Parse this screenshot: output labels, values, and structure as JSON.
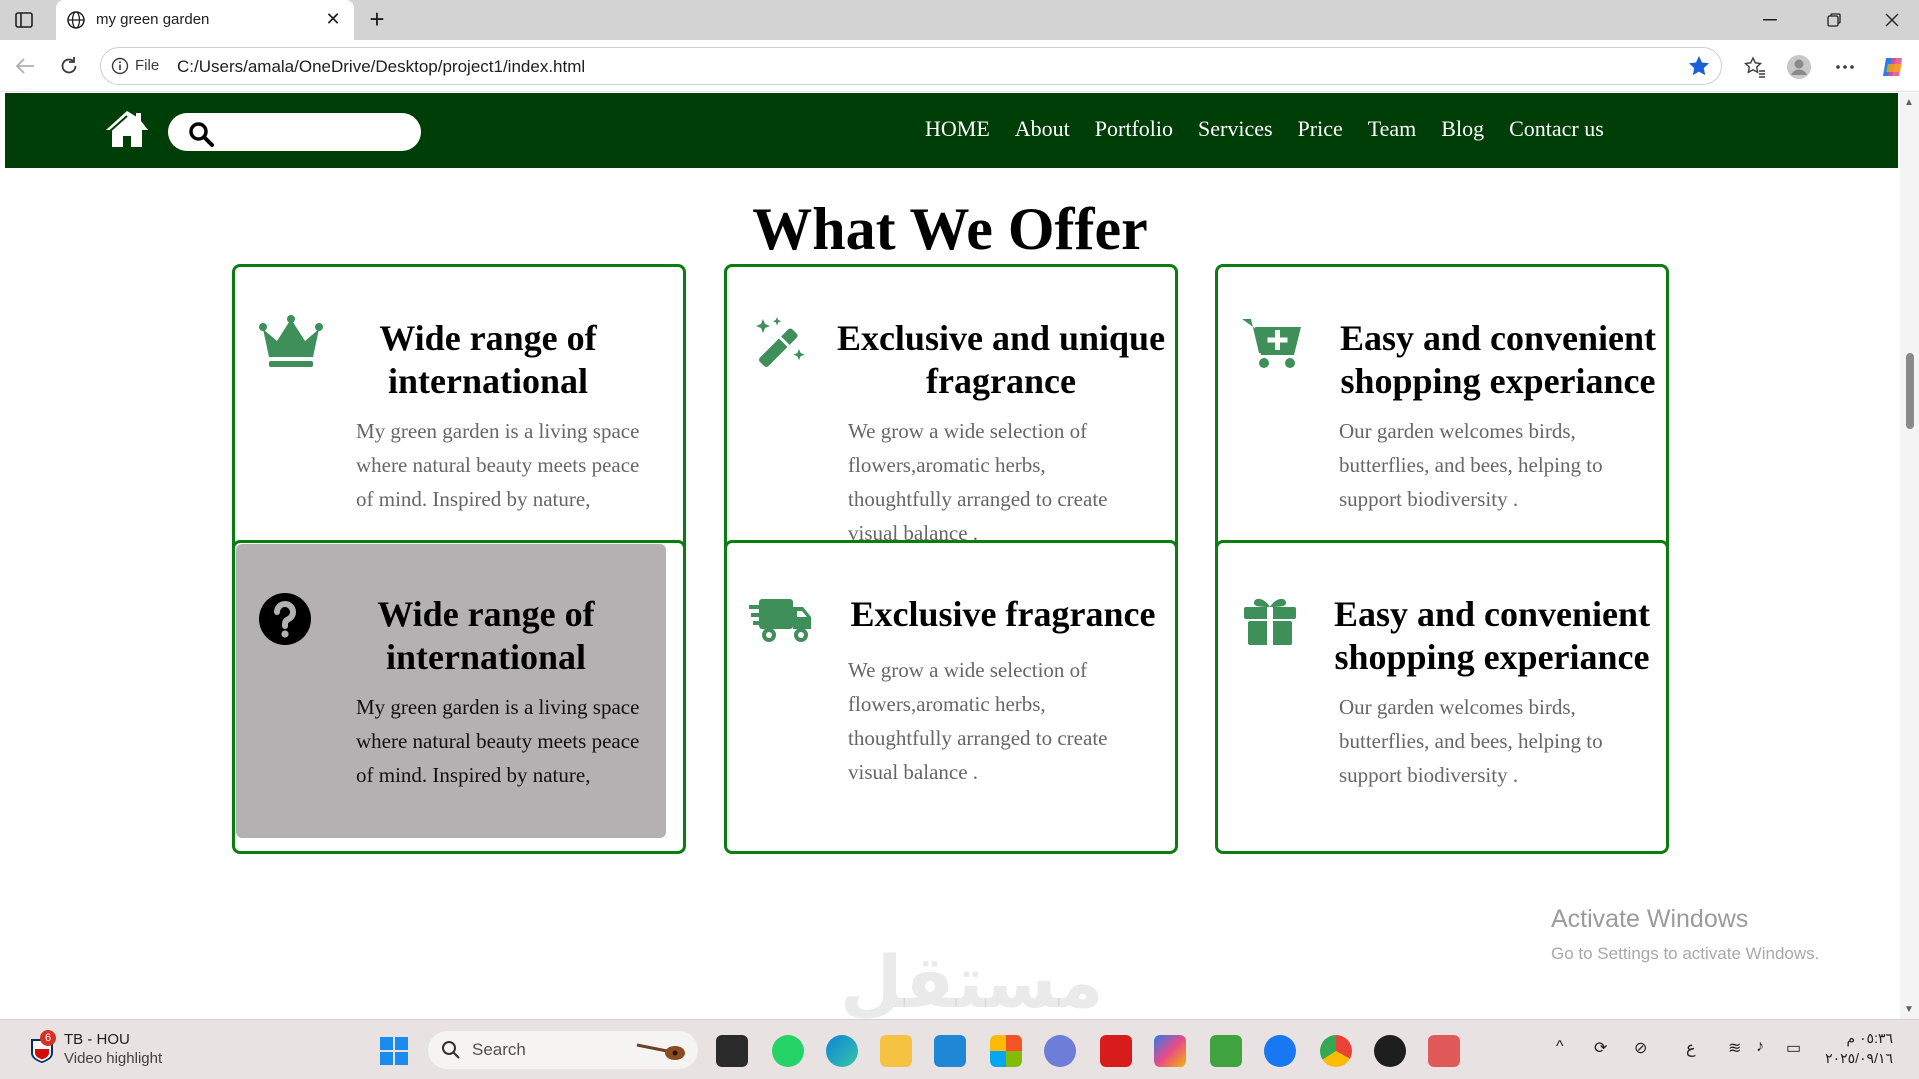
{
  "browser": {
    "tab_title": "my green garden",
    "scheme_label": "File",
    "url": "C:/Users/amala/OneDrive/Desktop/project1/index.html",
    "new_tab_symbol": "+",
    "close_symbol": "✕"
  },
  "site": {
    "search_placeholder": "",
    "menu": [
      "HOME",
      "About",
      "Portfolio",
      "Services",
      "Price",
      "Team",
      "Blog",
      "Contacr us"
    ],
    "section_title": "What We Offer",
    "brand_color": "#003e07",
    "card_border_color": "#0a7c10",
    "icon_color": "#3f8f5b"
  },
  "cards": [
    {
      "icon": "crown-icon",
      "title_l1": "Wide range of",
      "title_l2": "international",
      "text": [
        "My green garden is a living space",
        "where natural beauty meets peace",
        "of mind. Inspired by nature,"
      ]
    },
    {
      "icon": "magic-wand-icon",
      "title_l1": "Exclusive and unique",
      "title_l2": "fragrance",
      "text": [
        "We grow a wide selection of",
        "flowers,aromatic herbs,",
        "thoughtfully arranged to create",
        "visual balance ."
      ]
    },
    {
      "icon": "cart-plus-icon",
      "title_l1": "Easy and convenient",
      "title_l2": "shopping experiance",
      "text": [
        "Our garden welcomes birds,",
        "butterflies, and bees, helping to",
        "support biodiversity ."
      ]
    },
    {
      "icon": "question-circle-icon",
      "title_l1": "Wide range of",
      "title_l2": "international",
      "text": [
        "My green garden is a living space",
        "where natural beauty meets peace",
        "of mind. Inspired by nature,"
      ]
    },
    {
      "icon": "truck-icon",
      "title_l1": "Exclusive fragrance",
      "title_l2": "",
      "text": [
        "We grow a wide selection of",
        "flowers,aromatic herbs,",
        "thoughtfully arranged to create",
        "visual balance ."
      ]
    },
    {
      "icon": "gift-icon",
      "title_l1": "Easy and convenient",
      "title_l2": "shopping experiance",
      "text": [
        "Our garden welcomes birds,",
        "butterflies, and bees, helping to",
        "support biodiversity ."
      ]
    }
  ],
  "overlay": {
    "activate_title": "Activate Windows",
    "activate_sub": "Go to Settings to activate Windows.",
    "mostaql": "مستقل"
  },
  "taskbar": {
    "widget_badge": "6",
    "widget_line1": "TB - HOU",
    "widget_line2": "Video highlight",
    "search_label": "Search",
    "lang": "ع",
    "time": "٠٥:٣٦ م",
    "date": "٢٠٢٥/٠٩/١٦"
  }
}
